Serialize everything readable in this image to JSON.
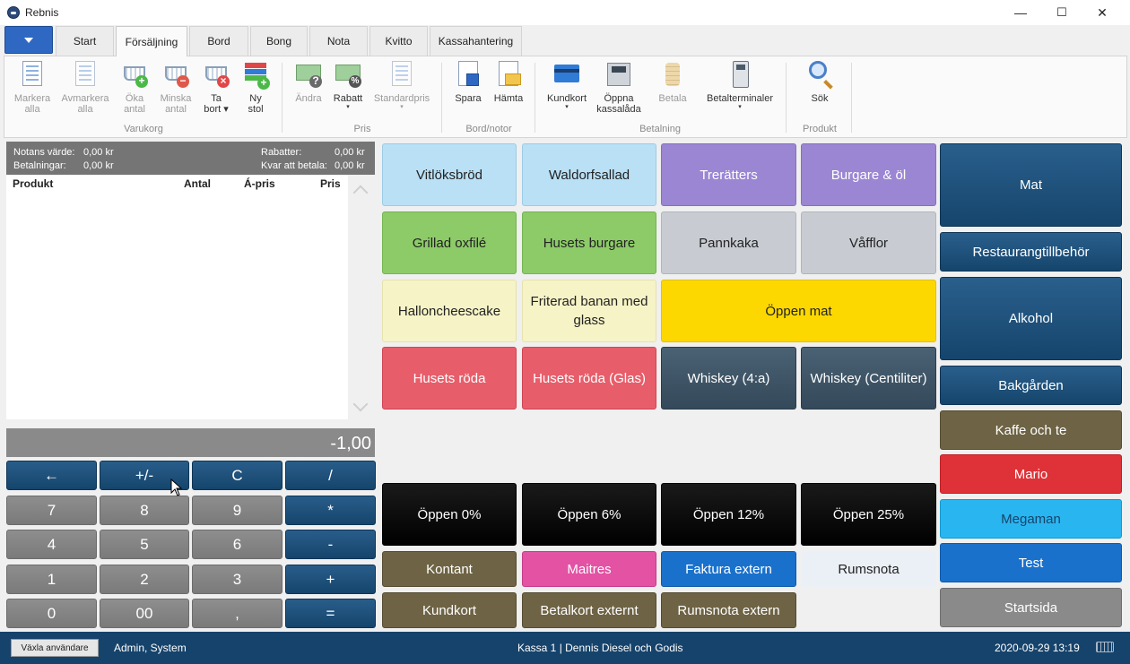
{
  "window": {
    "title": "Rebnis",
    "minimize": "—",
    "maximize": "☐",
    "close": "✕"
  },
  "tabs": [
    "Start",
    "Försäljning",
    "Bord",
    "Bong",
    "Nota",
    "Kvitto",
    "Kassahantering"
  ],
  "ribbon": {
    "varukorg": {
      "label": "Varukorg",
      "buttons": [
        {
          "l1": "Markera",
          "l2": "alla"
        },
        {
          "l1": "Avmarkera",
          "l2": "alla"
        },
        {
          "l1": "Öka",
          "l2": "antal"
        },
        {
          "l1": "Minska",
          "l2": "antal"
        },
        {
          "l1": "Ta",
          "l2": "bort ▾"
        },
        {
          "l1": "Ny",
          "l2": "stol"
        }
      ]
    },
    "pris": {
      "label": "Pris",
      "buttons": [
        {
          "l1": "Ändra",
          "l2": ""
        },
        {
          "l1": "Rabatt",
          "l2": "▾"
        },
        {
          "l1": "Standardpris",
          "l2": "▾"
        }
      ]
    },
    "bordnotor": {
      "label": "Bord/notor",
      "buttons": [
        {
          "l1": "Spara",
          "l2": ""
        },
        {
          "l1": "Hämta",
          "l2": ""
        }
      ]
    },
    "betalning": {
      "label": "Betalning",
      "buttons": [
        {
          "l1": "Kundkort",
          "l2": "▾"
        },
        {
          "l1": "Öppna",
          "l2": "kassalåda"
        },
        {
          "l1": "Betala",
          "l2": ""
        },
        {
          "l1": "Betalterminaler",
          "l2": "▾"
        }
      ]
    },
    "produkt": {
      "label": "Produkt",
      "buttons": [
        {
          "l1": "Sök",
          "l2": ""
        }
      ]
    }
  },
  "note": {
    "value_label": "Notans värde:",
    "value": "0,00 kr",
    "payments_label": "Betalningar:",
    "payments": "0,00 kr",
    "discounts_label": "Rabatter:",
    "discounts": "0,00 kr",
    "remaining_label": "Kvar att betala:",
    "remaining": "0,00 kr"
  },
  "list_columns": [
    "Produkt",
    "Antal",
    "Á-pris",
    "Pris"
  ],
  "keypad": {
    "display": "-1,00",
    "keys": [
      "←",
      "+/-",
      "C",
      "/",
      "7",
      "8",
      "9",
      "*",
      "4",
      "5",
      "6",
      "-",
      "1",
      "2",
      "3",
      "+",
      "0",
      "00",
      ",",
      "="
    ]
  },
  "products": [
    "Vitlöksbröd",
    "Waldorfsallad",
    "Trerätters",
    "Burgare & öl",
    "Grillad oxfilé",
    "Husets burgare",
    "Pannkaka",
    "Våfflor",
    "Halloncheescake",
    "Friterad banan med glass",
    "Öppen mat",
    "Husets röda",
    "Husets röda (Glas)",
    "Whiskey (4:a)",
    "Whiskey (Centiliter)"
  ],
  "open_items": [
    "Öppen 0%",
    "Öppen 6%",
    "Öppen 12%",
    "Öppen 25%"
  ],
  "payments": [
    "Kontant",
    "Maitres",
    "Faktura extern",
    "Rumsnota",
    "Kundkort",
    "Betalkort externt",
    "Rumsnota extern"
  ],
  "categories": [
    "Mat",
    "Restaurangtillbehör",
    "Alkohol",
    "Bakgården",
    "Kaffe och te",
    "Mario",
    "Megaman",
    "Test",
    "Startsida"
  ],
  "status": {
    "switch_user": "Växla användare",
    "user": "Admin, System",
    "register": "Kassa 1 | Dennis Diesel och Godis",
    "datetime": "2020-09-29 13:19"
  },
  "colors": {
    "accent": "#16436b",
    "light_blue": "#b9e0f5",
    "purple": "#9b86d3",
    "green": "#8dca68",
    "gray": "#c8ccd2",
    "cream": "#f6f3c6",
    "yellow": "#fdd800",
    "red": "#e85d6a",
    "dark_slate": "#3e5566",
    "brown": "#6e6344",
    "pink": "#e352a3",
    "blue": "#1a71cc",
    "cyan": "#29b6f0"
  }
}
